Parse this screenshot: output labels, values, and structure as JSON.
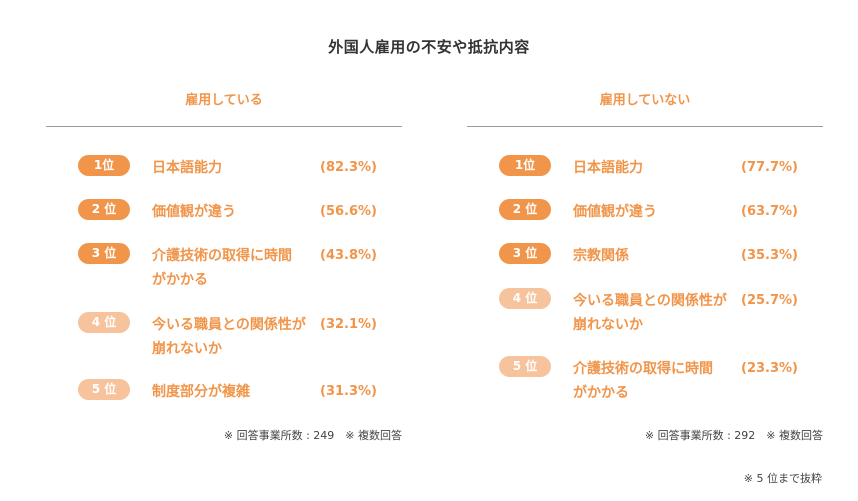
{
  "chart_data": {
    "type": "table",
    "title": "外国人雇用の不安や抵抗内容",
    "groups": [
      {
        "name": "雇用している",
        "note": "※ 回答事業所数 : 249　※ 複数回答",
        "rows": [
          {
            "rank": "1位",
            "item": "日本語能力",
            "value": 82.3,
            "value_label": "(82.3%)"
          },
          {
            "rank": "2 位",
            "item": "価値観が違う",
            "value": 56.6,
            "value_label": "(56.6%)"
          },
          {
            "rank": "3 位",
            "item": "介護技術の取得に時間がかかる",
            "value": 43.8,
            "value_label": "(43.8%)"
          },
          {
            "rank": "4 位",
            "item": "今いる職員との関係性が崩れないか",
            "value": 32.1,
            "value_label": "(32.1%)"
          },
          {
            "rank": "5 位",
            "item": "制度部分が複雑",
            "value": 31.3,
            "value_label": "(31.3%)"
          }
        ]
      },
      {
        "name": "雇用していない",
        "note": "※ 回答事業所数 : 292　※ 複数回答",
        "rows": [
          {
            "rank": "1位",
            "item": "日本語能力",
            "value": 77.7,
            "value_label": "(77.7%)"
          },
          {
            "rank": "2 位",
            "item": "価値観が違う",
            "value": 63.7,
            "value_label": "(63.7%)"
          },
          {
            "rank": "3 位",
            "item": "宗教関係",
            "value": 35.3,
            "value_label": "(35.3%)"
          },
          {
            "rank": "4 位",
            "item": "今いる職員との関係性が崩れないか",
            "value": 25.7,
            "value_label": "(25.7%)"
          },
          {
            "rank": "5 位",
            "item": "介護技術の取得に時間がかかる",
            "value": 23.3,
            "value_label": "(23.3%)"
          }
        ]
      }
    ],
    "footnote": "※ 5 位まで抜粋"
  },
  "colors": {
    "accent": "#f0954a",
    "badge_top": "#f0954a",
    "badge_light": "#f6c39c",
    "text": "#333333",
    "divider": "#9a9a9a"
  }
}
